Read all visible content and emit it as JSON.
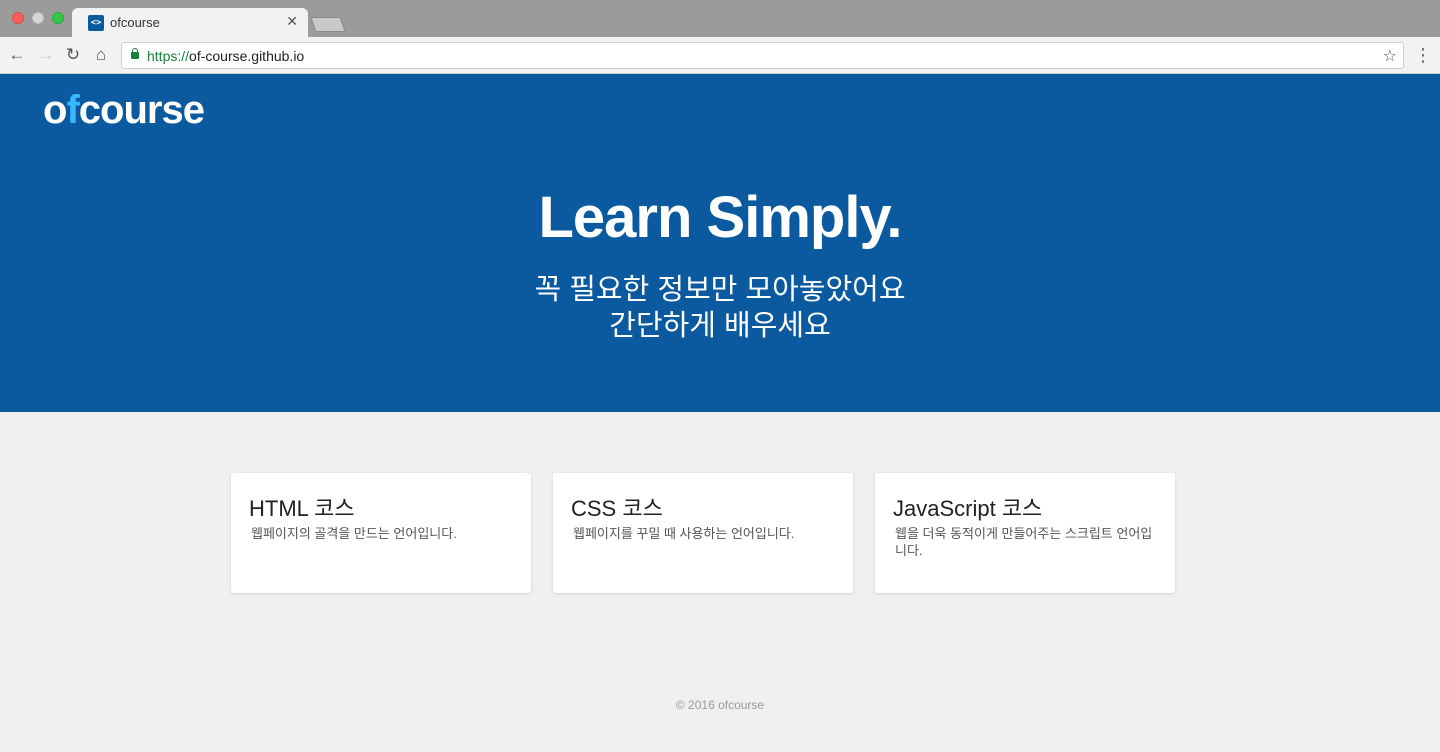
{
  "browser": {
    "tab_title": "ofcourse",
    "tab_icon_text": "<>",
    "url_scheme": "https://",
    "url_host": "of-course.github.io"
  },
  "hero": {
    "logo_prefix": "o",
    "logo_accent": "f",
    "logo_suffix": "course",
    "headline": "Learn Simply.",
    "subtitle_line1": "꼭 필요한 정보만 모아놓았어요",
    "subtitle_line2": "간단하게 배우세요"
  },
  "courses": [
    {
      "title": "HTML 코스",
      "description": "웹페이지의 골격을 만드는 언어입니다."
    },
    {
      "title": "CSS 코스",
      "description": "웹페이지를 꾸밀 때 사용하는 언어입니다."
    },
    {
      "title": "JavaScript 코스",
      "description": "웹을 더욱 동적이게 만들어주는 스크립트 언어입니다."
    }
  ],
  "footer": {
    "text": "© 2016 ofcourse"
  },
  "colors": {
    "brand": "#0b5aa0",
    "logo_accent": "#3ab8ff",
    "background": "#f0f0f0"
  },
  "icons": [
    "back-icon",
    "forward-icon",
    "reload-icon",
    "home-icon",
    "lock-icon",
    "star-icon",
    "menu-icon",
    "close-icon"
  ]
}
